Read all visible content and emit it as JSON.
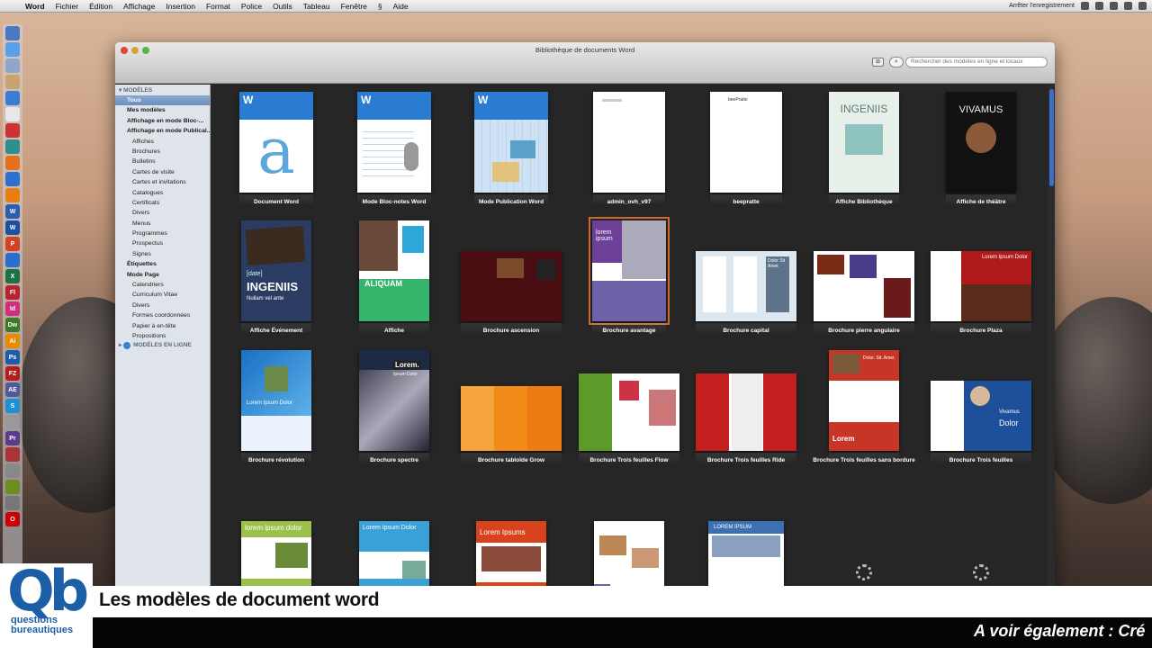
{
  "menubar": {
    "app_name": "Word",
    "items": [
      "Fichier",
      "Édition",
      "Affichage",
      "Insertion",
      "Format",
      "Police",
      "Outils",
      "Tableau",
      "Fenêtre"
    ],
    "help": "Aide",
    "recording": "Arrêter l'enregistrement"
  },
  "window": {
    "title": "Bibliothèque de documents Word",
    "search_placeholder": "Rechercher des modèles en ligne et locaux"
  },
  "sidebar": {
    "header_templates": "MODÈLES",
    "header_online": "MODÈLES EN LIGNE",
    "items": [
      {
        "label": "Tous",
        "level": 1,
        "selected": true
      },
      {
        "label": "Mes modèles",
        "level": 1
      },
      {
        "label": "Affichage en mode Bloc-...",
        "level": 1
      },
      {
        "label": "Affichage en mode Publical...",
        "level": 1
      },
      {
        "label": "Affiches",
        "level": 2
      },
      {
        "label": "Brochures",
        "level": 2
      },
      {
        "label": "Bulletins",
        "level": 2
      },
      {
        "label": "Cartes de visite",
        "level": 2
      },
      {
        "label": "Cartes et invitations",
        "level": 2
      },
      {
        "label": "Catalogues",
        "level": 2
      },
      {
        "label": "Certificats",
        "level": 2
      },
      {
        "label": "Divers",
        "level": 2
      },
      {
        "label": "Menus",
        "level": 2
      },
      {
        "label": "Programmes",
        "level": 2
      },
      {
        "label": "Prospectus",
        "level": 2
      },
      {
        "label": "Signes",
        "level": 2
      },
      {
        "label": "Étiquettes",
        "level": 1
      },
      {
        "label": "Mode Page",
        "level": 1
      },
      {
        "label": "Calendriers",
        "level": 2
      },
      {
        "label": "Curriculum Vitae",
        "level": 2
      },
      {
        "label": "Divers",
        "level": 2
      },
      {
        "label": "Formes coordonnées",
        "level": 2
      },
      {
        "label": "Papier à en-tête",
        "level": 2
      },
      {
        "label": "Propositions",
        "level": 2
      }
    ]
  },
  "templates": [
    {
      "name": "Document Word",
      "style": "word-a"
    },
    {
      "name": "Mode Bloc-notes Word",
      "style": "word-notes"
    },
    {
      "name": "Mode Publication Word",
      "style": "word-pub"
    },
    {
      "name": "admin_ovh_v97",
      "style": "blank"
    },
    {
      "name": "beepratte",
      "style": "blank-logo",
      "logo_text": "beePratte"
    },
    {
      "name": "Affiche Bibliothèque",
      "style": "ingeniis-mint",
      "poster_text": "INGENIIS"
    },
    {
      "name": "Affiche de théâtre",
      "style": "vivamus",
      "poster_text": "VIVAMUS"
    },
    {
      "name": "Affiche Événement",
      "style": "ingeniis-event",
      "poster_text": "INGENIIS",
      "poster_sub": "Nullam vel ante",
      "poster_tag": "[date]"
    },
    {
      "name": "Affiche",
      "style": "aliquam",
      "poster_text": "ALIQUAM"
    },
    {
      "name": "Brochure ascension",
      "style": "brochure-dark"
    },
    {
      "name": "Brochure avantage",
      "style": "lorem-purple",
      "selected": true,
      "poster_text": "lorem ipsum"
    },
    {
      "name": "Brochure capital",
      "style": "capital",
      "poster_text": "Dolor Sit Amet"
    },
    {
      "name": "Brochure pierre angulaire",
      "style": "angulaire"
    },
    {
      "name": "Brochure Plaza",
      "style": "plaza",
      "poster_text": "Lorem Ipsum Dolor"
    },
    {
      "name": "Brochure révolution",
      "style": "revolution",
      "poster_text": "Lorem Ipsum Dolor"
    },
    {
      "name": "Brochure spectre",
      "style": "spectre",
      "poster_text": "Lorem.",
      "poster_sub": "Ipsum Dolor"
    },
    {
      "name": "Brochure tabloïde Grow",
      "style": "grow"
    },
    {
      "name": "Brochure Trois feuilles Flow",
      "style": "flow"
    },
    {
      "name": "Brochure Trois feuilles Ride",
      "style": "ride"
    },
    {
      "name": "Brochure Trois feuilles sans bordure",
      "style": "sansbordure",
      "poster_text": "Lorem",
      "poster_sub": "Dolor. Sit. Amet."
    },
    {
      "name": "Brochure Trois feuilles",
      "style": "trois",
      "poster_text": "Vivamus",
      "poster_sub": "Dolor"
    },
    {
      "name": "",
      "style": "lorem-green",
      "poster_text": "lorem ipsum dolor"
    },
    {
      "name": "",
      "style": "lorem-blue",
      "poster_text": "Lorem Ipsum Dolor"
    },
    {
      "name": "",
      "style": "lorem-red",
      "poster_text": "Lorem Ipsums"
    },
    {
      "name": "",
      "style": "menu-page"
    },
    {
      "name": "",
      "style": "news-blue",
      "poster_text": "LOREM IPSUM"
    },
    {
      "name": "",
      "style": "loading"
    },
    {
      "name": "",
      "style": "loading"
    }
  ],
  "footer": {
    "title": "Les modèles de document word",
    "ticker": "A voir également : Cré",
    "logo_mark": "Qb",
    "logo_line1": "questions",
    "logo_line2": "bureautiques"
  },
  "colors": {
    "accent_selection": "#c96b2e",
    "brand_blue": "#1d5fa6",
    "sidebar_selected": "#6d8fbf"
  }
}
